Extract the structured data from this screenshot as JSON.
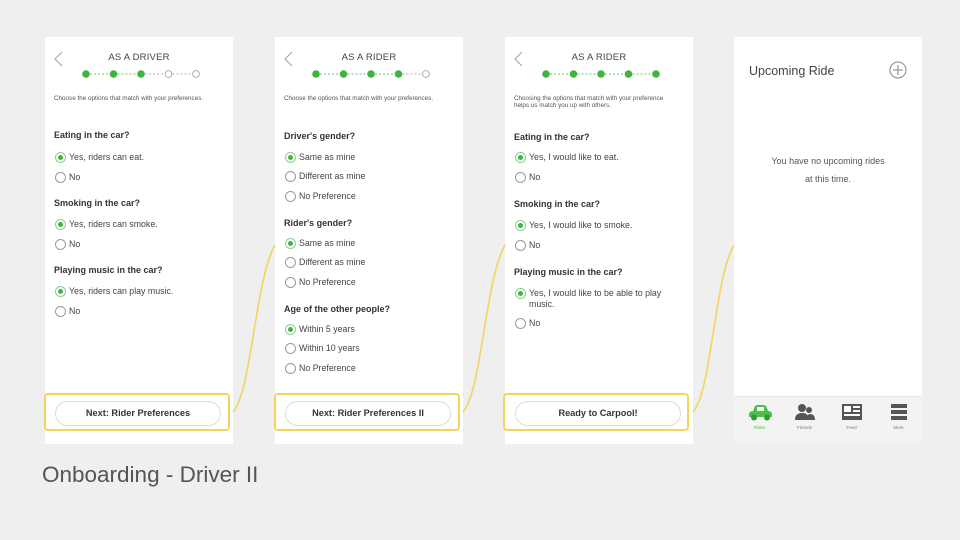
{
  "screens": [
    {
      "title": "AS A DRIVER",
      "intro": "Choose the options that match with your preferences.",
      "progress": {
        "total": 5,
        "completed": 3
      },
      "questions": [
        {
          "label": "Eating in the car?",
          "options": [
            "Yes, riders can eat.",
            "No"
          ],
          "selected": 0
        },
        {
          "label": "Smoking in the car?",
          "options": [
            "Yes, riders can smoke.",
            "No"
          ],
          "selected": 0
        },
        {
          "label": "Playing music in the car?",
          "options": [
            "Yes, riders can play music.",
            "No"
          ],
          "selected": 0
        }
      ],
      "cta": "Next: Rider Preferences"
    },
    {
      "title": "AS A RIDER",
      "intro": "Choose the options that match with your preferences.",
      "progress": {
        "total": 5,
        "completed": 4
      },
      "questions": [
        {
          "label": "Driver's gender?",
          "options": [
            "Same as mine",
            "Different as mine",
            "No Preference"
          ],
          "selected": 0
        },
        {
          "label": "Rider's gender?",
          "options": [
            "Same as mine",
            "Different as mine",
            "No Preference"
          ],
          "selected": 0
        },
        {
          "label": "Age of the other people?",
          "options": [
            "Within 5 years",
            "Within 10 years",
            "No Preference"
          ],
          "selected": 0
        }
      ],
      "cta": "Next: Rider Preferences II"
    },
    {
      "title": "AS A RIDER",
      "intro": "Choosing the options that match with your preference helps us match you up with others.",
      "progress": {
        "total": 5,
        "completed": 5
      },
      "questions": [
        {
          "label": "Eating in the car?",
          "options": [
            "Yes, I would like to eat.",
            "No"
          ],
          "selected": 0
        },
        {
          "label": "Smoking in the car?",
          "options": [
            "Yes, I would like to smoke.",
            "No"
          ],
          "selected": 0
        },
        {
          "label": "Playing music in the car?",
          "options": [
            "Yes, I would like to be able to play music.",
            "No"
          ],
          "selected": 0
        }
      ],
      "cta": "Ready to Carpool!"
    }
  ],
  "upcoming": {
    "title": "Upcoming Ride",
    "empty_message": "You have no upcoming rides at this time.",
    "tabs": [
      {
        "label": "Rides",
        "icon": "car-icon",
        "active": true
      },
      {
        "label": "Friends",
        "icon": "friends-icon",
        "active": false
      },
      {
        "label": "Feed",
        "icon": "feed-icon",
        "active": false
      },
      {
        "label": "More",
        "icon": "menu-icon",
        "active": false
      }
    ]
  },
  "slide_title": "Onboarding - Driver II",
  "colors": {
    "accent_green": "#3eb53e",
    "highlight_yellow": "#f4d35e",
    "background": "#efefef"
  }
}
